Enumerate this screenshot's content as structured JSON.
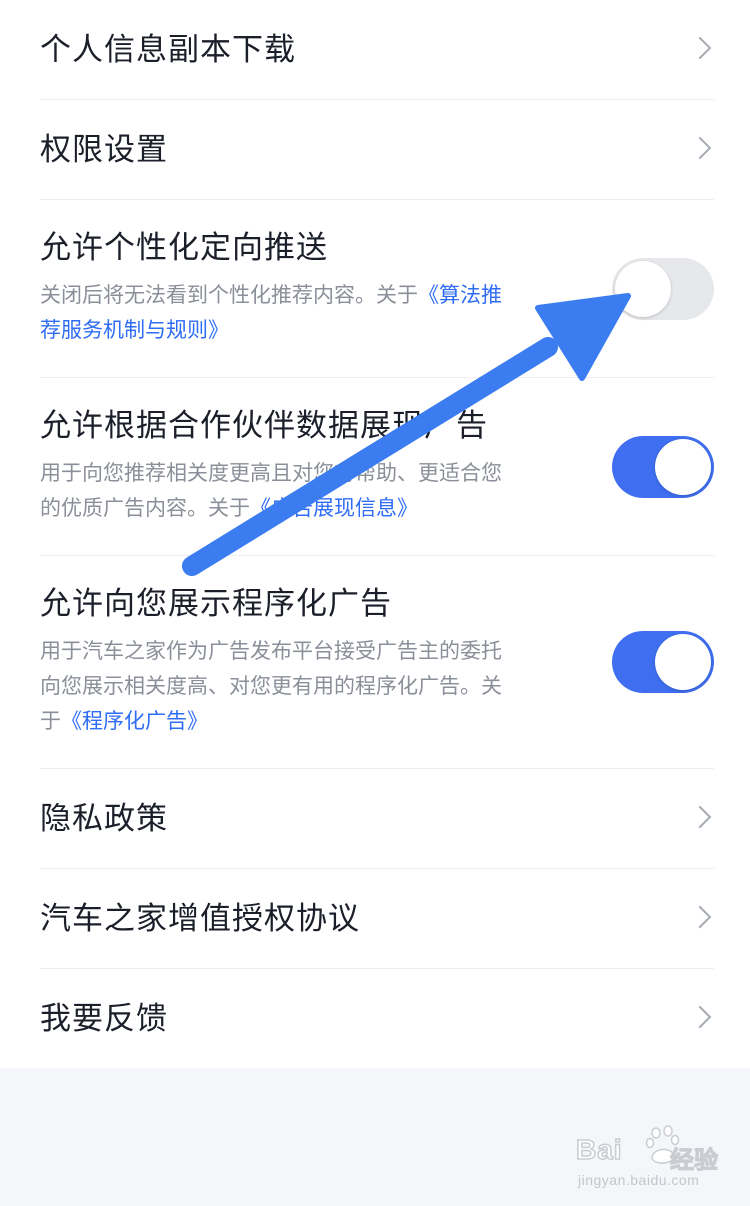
{
  "items": [
    {
      "title": "个人信息副本下载"
    },
    {
      "title": "权限设置"
    }
  ],
  "switches": [
    {
      "title": "允许个性化定向推送",
      "desc_lines": [
        {
          "text": "关闭后将无法看到个性化推荐内容。关于",
          "link": "《算法推"
        },
        {
          "text": "",
          "link": "荐服务机制与规则》"
        }
      ],
      "state": "off"
    },
    {
      "title": "允许根据合作伙伴数据展现广告",
      "desc_lines": [
        {
          "text": "用于向您推荐相关度更高且对您有帮助、更适合您",
          "link": ""
        },
        {
          "text": "的优质广告内容。关于",
          "link": "《广告展现信息》"
        }
      ],
      "state": "on"
    },
    {
      "title": "允许向您展示程序化广告",
      "desc_lines": [
        {
          "text": "用于汽车之家作为广告发布平台接受广告主的委托",
          "link": ""
        },
        {
          "text": "向您展示相关度高、对您更有用的程序化广告。关",
          "link": ""
        },
        {
          "text": "于",
          "link": "《程序化广告》"
        }
      ],
      "state": "on"
    }
  ],
  "bottom_items": [
    {
      "title": "隐私政策"
    },
    {
      "title": "汽车之家增值授权协议"
    },
    {
      "title": "我要反馈"
    }
  ],
  "watermark": {
    "logo": "Bai",
    "logo_suffix": "经验",
    "url": "jingyan.baidu.com"
  },
  "colors": {
    "accent": "#3f6ff0",
    "link": "#2f6df6",
    "arrow": "#3b7cf0"
  }
}
